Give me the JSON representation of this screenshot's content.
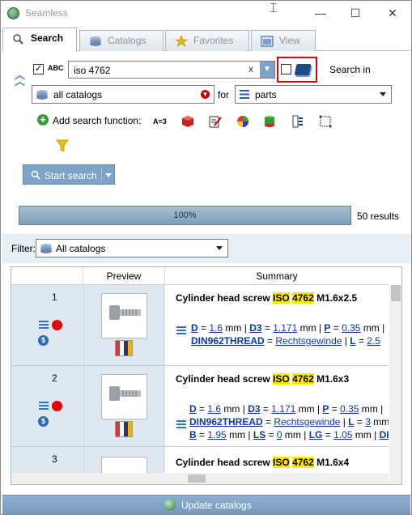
{
  "window": {
    "title": "Seamless",
    "controls": {
      "minimize": "—",
      "maximize": "☐",
      "close": "✕"
    }
  },
  "tabs": [
    {
      "label": "Search",
      "icon": "search-icon",
      "active": true
    },
    {
      "label": "Catalogs",
      "icon": "catalogs-icon",
      "active": false
    },
    {
      "label": "Favorites",
      "icon": "star-icon",
      "active": false
    },
    {
      "label": "View",
      "icon": "view-icon",
      "active": false
    }
  ],
  "search": {
    "fulltext_checked": true,
    "abc_label": "ABC",
    "query": "iso 4762",
    "clear_glyph": "x",
    "search_in_checked": false,
    "search_in_label": "Search in",
    "catalog_select": "all catalogs",
    "for_label": "for",
    "type_select": "parts",
    "add_function_label": "Add search function:",
    "function_icons": [
      "text-search-icon",
      "cube-icon",
      "edit-form-icon",
      "color-icon",
      "geometry-icon",
      "table-icon",
      "sketch-icon",
      "filter-icon"
    ],
    "start_button": "Start search",
    "progress_percent": 100,
    "progress_label": "100%",
    "results_count": "50 results"
  },
  "filter": {
    "label": "Filter:",
    "value": "All catalogs"
  },
  "grid": {
    "headers": {
      "preview": "Preview",
      "summary": "Summary"
    },
    "rows": [
      {
        "index": "1",
        "title_pre": "Cylinder head screw ",
        "title_hl1": "ISO",
        "title_mid": " ",
        "title_hl2": "4762",
        "title_post": " M1.6x2.5",
        "line1": {
          "k1": "D",
          "v1": "1.6",
          "k2": "D3",
          "v2": "1.171",
          "k3": "P",
          "v3": "0.35",
          "unit": "mm"
        },
        "line2": {
          "k1": "DIN962THREAD",
          "v1": "Rechtsgewinde",
          "k2": "L",
          "v2": "2.5"
        }
      },
      {
        "index": "2",
        "title_pre": "Cylinder head screw ",
        "title_hl1": "ISO",
        "title_mid": " ",
        "title_hl2": "4762",
        "title_post": " M1.6x3",
        "line1": {
          "k1": "D",
          "v1": "1.6",
          "k2": "D3",
          "v2": "1.171",
          "k3": "P",
          "v3": "0.35",
          "unit": "mm"
        },
        "line2": {
          "k1": "DIN962THREAD",
          "v1": "Rechtsgewinde",
          "k2": "L",
          "v2": "3",
          "unit": "mm"
        },
        "line3": {
          "k1": "B",
          "v1": "1.95",
          "k2": "LS",
          "v2": "0",
          "k3": "LG",
          "v3": "1.05",
          "k4": "DK",
          "unit": "mm"
        }
      },
      {
        "index": "3",
        "title_pre": "Cylinder head screw ",
        "title_hl1": "ISO",
        "title_mid": " ",
        "title_hl2": "4762",
        "title_post": " M1.6x4"
      }
    ]
  },
  "footer": {
    "update_button": "Update catalogs"
  }
}
